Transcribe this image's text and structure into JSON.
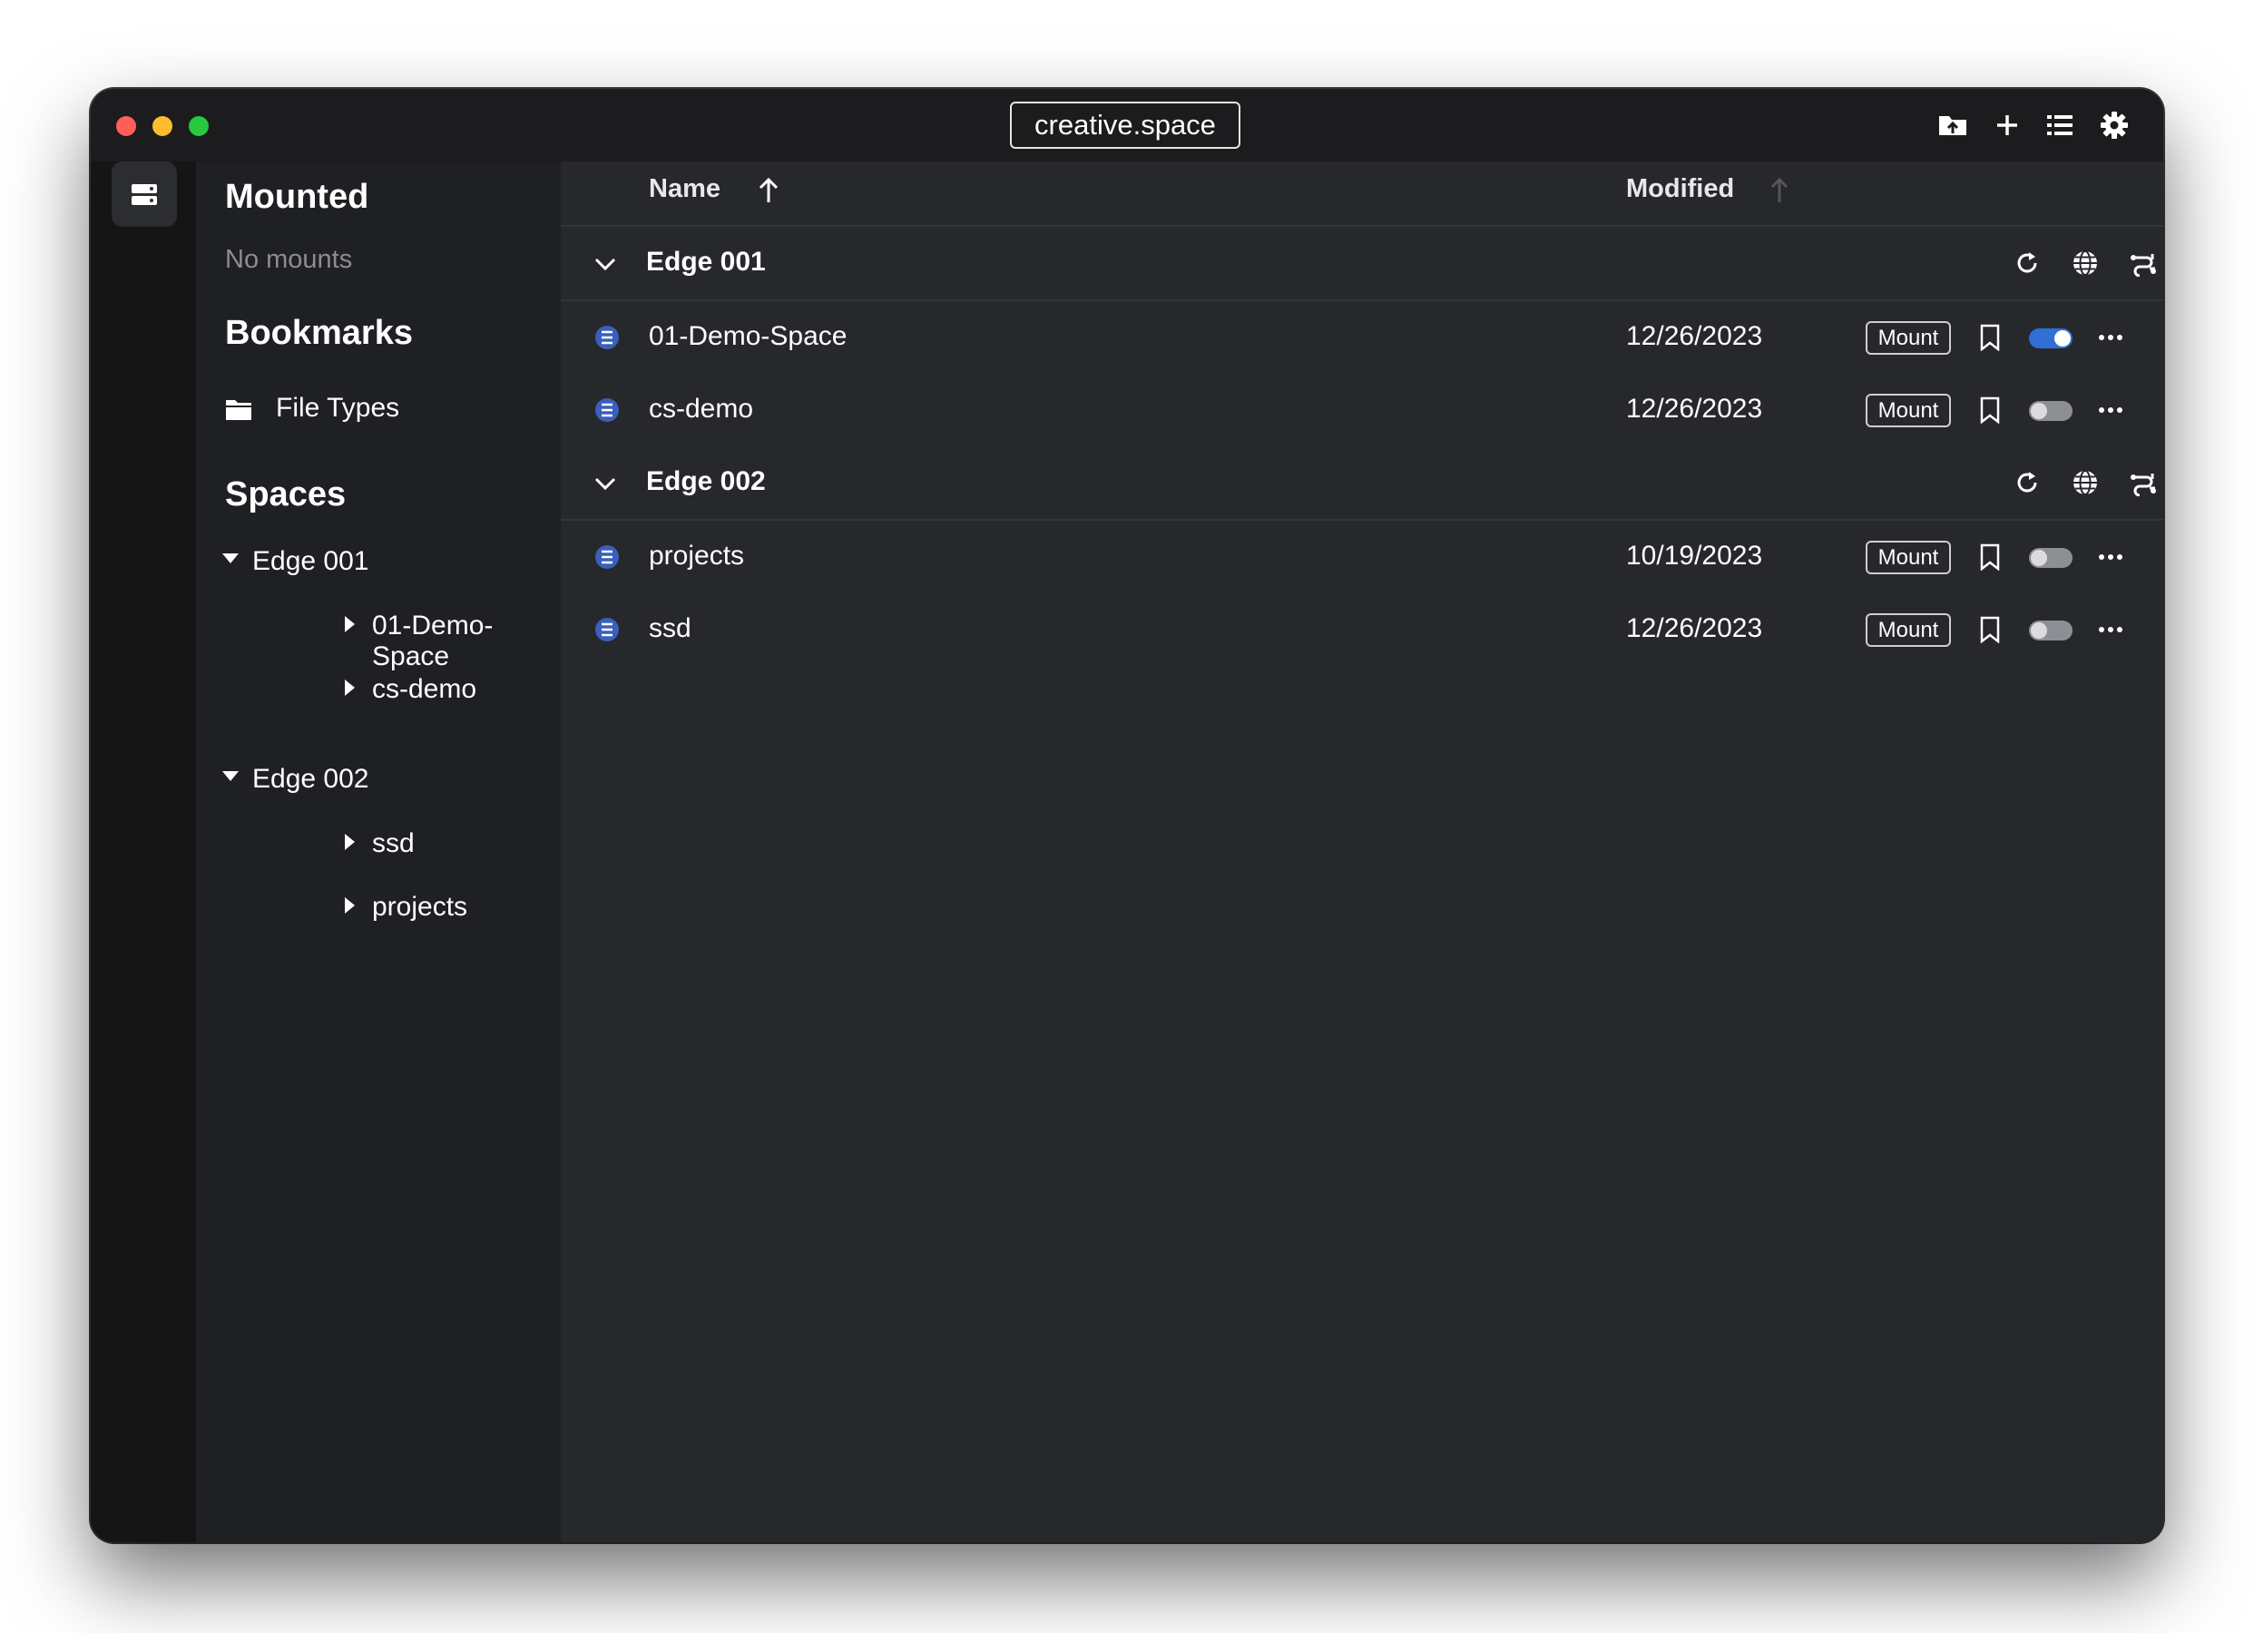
{
  "window": {
    "title": "creative.space"
  },
  "toolbar": {
    "icons": [
      "upload-folder-icon",
      "plus-icon",
      "list-view-icon",
      "gear-icon"
    ]
  },
  "sidebar": {
    "mounted": {
      "heading": "Mounted",
      "empty_text": "No mounts"
    },
    "bookmarks": {
      "heading": "Bookmarks",
      "items": [
        {
          "label": "File Types",
          "icon": "folder-icon"
        }
      ]
    },
    "spaces": {
      "heading": "Spaces",
      "groups": [
        {
          "label": "Edge 001",
          "children": [
            {
              "label": "01-Demo-Space"
            },
            {
              "label": "cs-demo"
            }
          ]
        },
        {
          "label": "Edge 002",
          "children": [
            {
              "label": "ssd"
            },
            {
              "label": "projects"
            }
          ]
        }
      ]
    }
  },
  "table": {
    "columns": {
      "name": "Name",
      "modified": "Modified"
    },
    "sort": {
      "column": "Name",
      "direction": "ascending"
    },
    "mount_label": "Mount",
    "groups": [
      {
        "title": "Edge 001",
        "items": [
          {
            "name": "01-Demo-Space",
            "modified": "12/26/2023",
            "enabled": true
          },
          {
            "name": "cs-demo",
            "modified": "12/26/2023",
            "enabled": false
          }
        ]
      },
      {
        "title": "Edge 002",
        "items": [
          {
            "name": "projects",
            "modified": "10/19/2023",
            "enabled": false
          },
          {
            "name": "ssd",
            "modified": "12/26/2023",
            "enabled": false
          }
        ]
      }
    ]
  },
  "colors": {
    "accent": "#2f6fd6",
    "window_bg": "#27282c",
    "sidebar_bg": "#1f2023",
    "titlebar_bg": "#1c1c1e"
  }
}
